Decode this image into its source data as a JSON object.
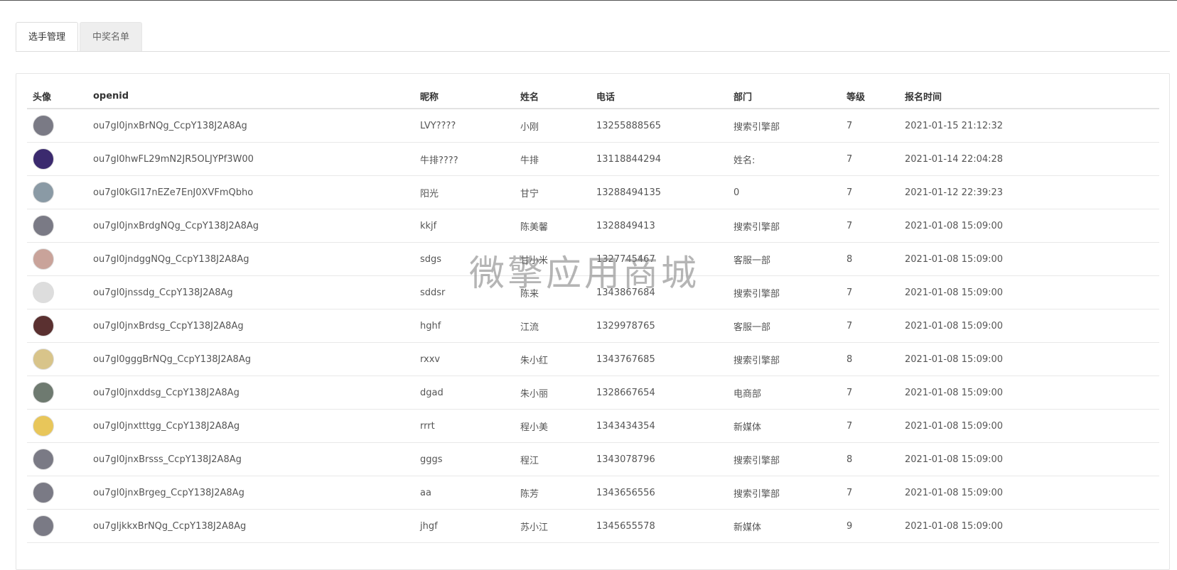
{
  "tabs": [
    {
      "label": "选手管理",
      "active": true
    },
    {
      "label": "中奖名单",
      "active": false
    }
  ],
  "table": {
    "headers": [
      "头像",
      "openid",
      "昵称",
      "姓名",
      "电话",
      "部门",
      "等级",
      "报名时间"
    ],
    "rows": [
      {
        "avatar_color": "#7a7a85",
        "openid": "ou7gl0jnxBrNQg_CcpY138J2A8Ag",
        "nickname": "LVY????",
        "name": "小刚",
        "phone": "13255888565",
        "dept": "搜索引擎部",
        "level": "7",
        "time": "2021-01-15 21:12:32"
      },
      {
        "avatar_color": "#3b2a6e",
        "openid": "ou7gl0hwFL29mN2JR5OLJYPf3W00",
        "nickname": "牛排????",
        "name": "牛排",
        "phone": "13118844294",
        "dept": "姓名:",
        "level": "7",
        "time": "2021-01-14 22:04:28"
      },
      {
        "avatar_color": "#8a9aa5",
        "openid": "ou7gl0kGl17nEZe7EnJ0XVFmQbho",
        "nickname": "阳光",
        "name": "甘宁",
        "phone": "13288494135",
        "dept": "0",
        "level": "7",
        "time": "2021-01-12 22:39:23"
      },
      {
        "avatar_color": "#7a7a85",
        "openid": "ou7gl0jnxBrdgNQg_CcpY138J2A8Ag",
        "nickname": "kkjf",
        "name": "陈美馨",
        "phone": "1328849413",
        "dept": "搜索引擎部",
        "level": "7",
        "time": "2021-01-08 15:09:00"
      },
      {
        "avatar_color": "#c9a39a",
        "openid": "ou7gl0jndggNQg_CcpY138J2A8Ag",
        "nickname": "sdgs",
        "name": "甘小米",
        "phone": "1327745467",
        "dept": "客服一部",
        "level": "8",
        "time": "2021-01-08 15:09:00"
      },
      {
        "avatar_color": "#dddddd",
        "openid": "ou7gl0jnssdg_CcpY138J2A8Ag",
        "nickname": "sddsr",
        "name": "陈来",
        "phone": "1343867684",
        "dept": "搜索引擎部",
        "level": "7",
        "time": "2021-01-08 15:09:00"
      },
      {
        "avatar_color": "#5a3030",
        "openid": "ou7gl0jnxBrdsg_CcpY138J2A8Ag",
        "nickname": "hghf",
        "name": "江流",
        "phone": "1329978765",
        "dept": "客服一部",
        "level": "7",
        "time": "2021-01-08 15:09:00"
      },
      {
        "avatar_color": "#d8c48a",
        "openid": "ou7gl0gggBrNQg_CcpY138J2A8Ag",
        "nickname": "rxxv",
        "name": "朱小红",
        "phone": "1343767685",
        "dept": "搜索引擎部",
        "level": "8",
        "time": "2021-01-08 15:09:00"
      },
      {
        "avatar_color": "#6e7a70",
        "openid": "ou7gl0jnxddsg_CcpY138J2A8Ag",
        "nickname": "dgad",
        "name": "朱小丽",
        "phone": "1328667654",
        "dept": "电商部",
        "level": "7",
        "time": "2021-01-08 15:09:00"
      },
      {
        "avatar_color": "#e8c65a",
        "openid": "ou7gl0jnxtttgg_CcpY138J2A8Ag",
        "nickname": "rrrt",
        "name": "程小美",
        "phone": "1343434354",
        "dept": "新媒体",
        "level": "7",
        "time": "2021-01-08 15:09:00"
      },
      {
        "avatar_color": "#7a7a85",
        "openid": "ou7gl0jnxBrsss_CcpY138J2A8Ag",
        "nickname": "gggs",
        "name": "程江",
        "phone": "1343078796",
        "dept": "搜索引擎部",
        "level": "8",
        "time": "2021-01-08 15:09:00"
      },
      {
        "avatar_color": "#7a7a85",
        "openid": "ou7gl0jnxBrgeg_CcpY138J2A8Ag",
        "nickname": "aa",
        "name": "陈芳",
        "phone": "1343656556",
        "dept": "搜索引擎部",
        "level": "7",
        "time": "2021-01-08 15:09:00"
      },
      {
        "avatar_color": "#7a7a85",
        "openid": "ou7gljkkxBrNQg_CcpY138J2A8Ag",
        "nickname": "jhgf",
        "name": "苏小江",
        "phone": "1345655578",
        "dept": "新媒体",
        "level": "9",
        "time": "2021-01-08 15:09:00"
      }
    ]
  },
  "watermark": "微擎应用商城"
}
